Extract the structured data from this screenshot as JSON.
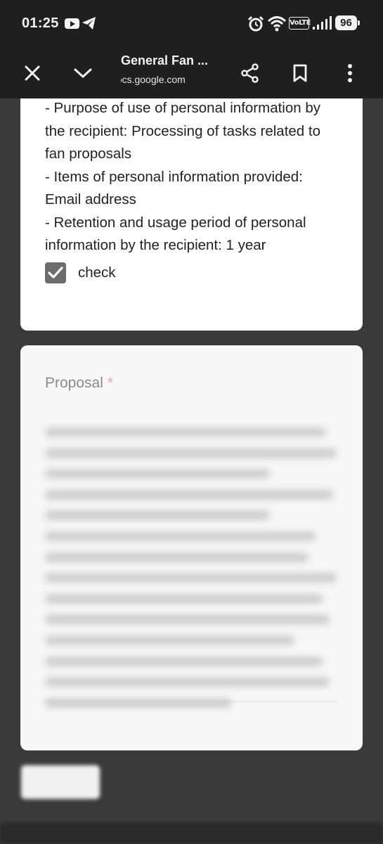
{
  "status_bar": {
    "time": "01:25",
    "volte": "VoLTE",
    "battery": "96",
    "icons": [
      "youtube-icon",
      "telegram-icon",
      "alarm-icon",
      "wifi-icon",
      "signal-icon"
    ]
  },
  "toolbar": {
    "title": "General Fan ...",
    "url": "docs.google.com",
    "icons": [
      "close-icon",
      "chevron-down-icon",
      "share-icon",
      "bookmark-icon",
      "more-vert-icon"
    ]
  },
  "consent": {
    "lines": [
      "- Purpose of use of personal information by",
      "the recipient: Processing of tasks related to",
      "fan proposals",
      "- Items of personal information provided:",
      "Email address",
      "- Retention and usage period of personal",
      "information by the recipient: 1 year"
    ],
    "checkbox_label": "check",
    "checked": true
  },
  "proposal": {
    "title": "Proposal",
    "required_marker": "*"
  },
  "colors": {
    "toolbar_bg": "#1f1f1f",
    "card_bg": "#ffffff",
    "checkbox": "#6d6d6d",
    "required": "#d93025"
  }
}
